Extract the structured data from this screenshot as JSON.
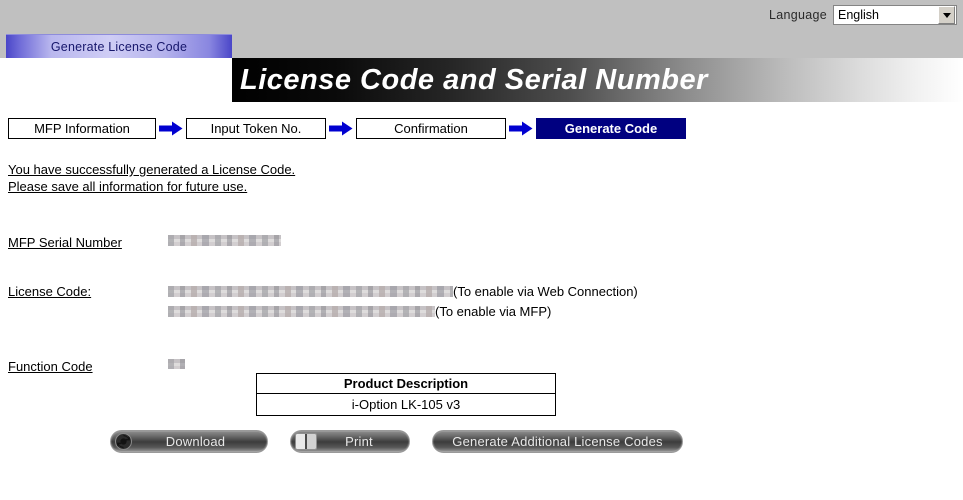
{
  "header": {
    "language_label": "Language",
    "language_value": "English",
    "caret_icon": "chevron-down-icon"
  },
  "tab": {
    "label": "Generate License Code"
  },
  "banner": {
    "title": "License Code and Serial Number"
  },
  "steps": [
    {
      "label": "MFP Information",
      "active": false
    },
    {
      "label": "Input Token No.",
      "active": false
    },
    {
      "label": "Confirmation",
      "active": false
    },
    {
      "label": "Generate Code",
      "active": true
    }
  ],
  "message": {
    "line1": "You have successfully generated a License Code.",
    "line2": "Please save all information for future use."
  },
  "fields": {
    "serial_label": "MFP Serial Number",
    "serial_value": "",
    "license_label": "License Code:",
    "license_note_web": "(To enable via Web Connection)",
    "license_note_mfp": "(To enable via MFP)",
    "function_label": "Function Code",
    "function_value": ""
  },
  "product_table": {
    "header": "Product Description",
    "value": "i-Option LK-105 v3"
  },
  "buttons": {
    "download": "Download",
    "print": "Print",
    "generate_more": "Generate Additional License Codes",
    "download_icon": "refresh-circle-icon",
    "print_icon": "printer-icon"
  },
  "colors": {
    "topbar": "#c0c0c0",
    "active_step": "#000080",
    "arrow": "#0000d0",
    "tab_text": "#16166b"
  }
}
